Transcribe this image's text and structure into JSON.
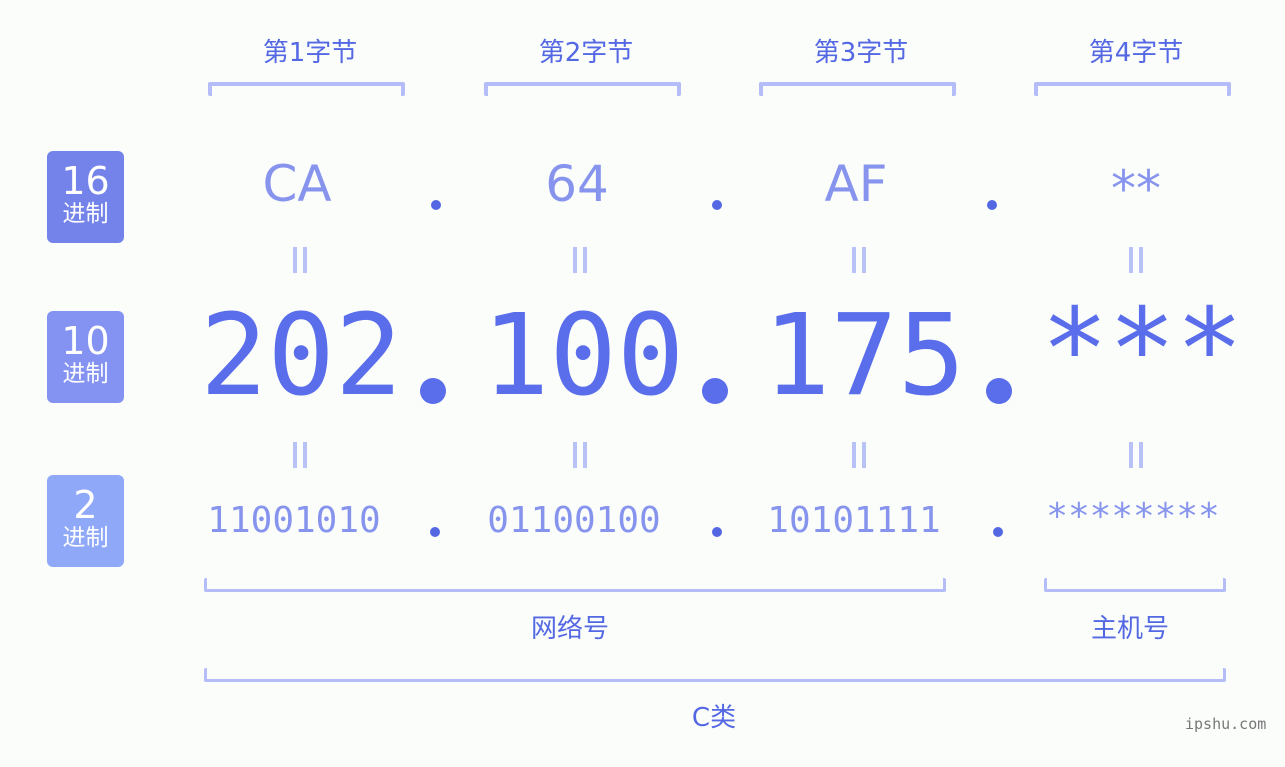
{
  "bytes": [
    {
      "label": "第1字节",
      "hex": "CA",
      "dec": "202",
      "bin": "11001010"
    },
    {
      "label": "第2字节",
      "hex": "64",
      "dec": "100",
      "bin": "01100100"
    },
    {
      "label": "第3字节",
      "hex": "AF",
      "dec": "175",
      "bin": "10101111"
    },
    {
      "label": "第4字节",
      "hex": "**",
      "dec": "***",
      "bin": "********"
    }
  ],
  "bases": [
    {
      "num": "16",
      "unit": "进制",
      "color": "#7483ea"
    },
    {
      "num": "10",
      "unit": "进制",
      "color": "#8493f2"
    },
    {
      "num": "2",
      "unit": "进制",
      "color": "#8fa8f7"
    }
  ],
  "groups": {
    "network": "网络号",
    "host": "主机号",
    "class": "C类"
  },
  "watermark": "ipshu.com",
  "colors": {
    "primary": "#5a6dea",
    "secondary": "#8794ee",
    "bracket": "#b4bdf7"
  }
}
